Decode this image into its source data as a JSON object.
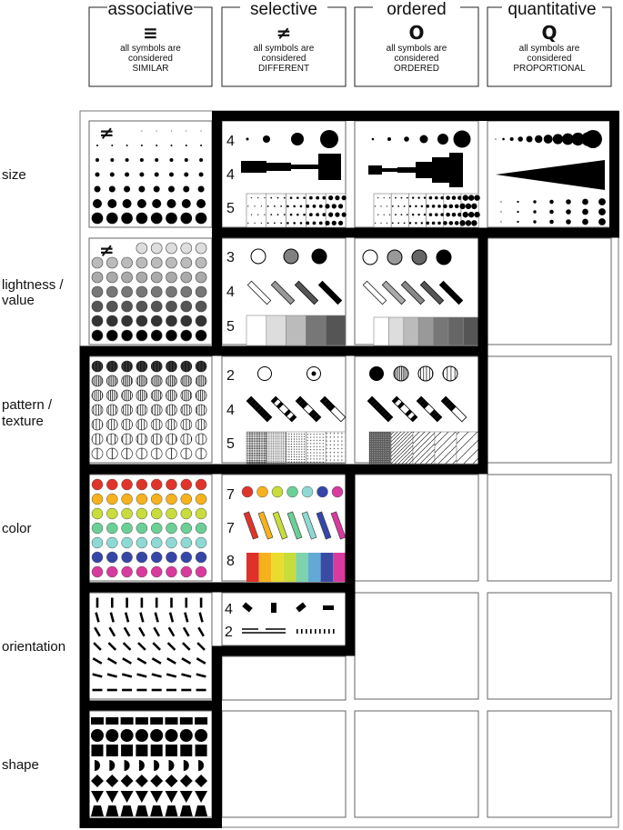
{
  "columns": [
    {
      "title": "associative",
      "symbol": "≡",
      "icon": "equivalent-icon",
      "line1": "all symbols are",
      "line2": "considered",
      "line3": "SIMILAR"
    },
    {
      "title": "selective",
      "symbol": "≠",
      "icon": "not-equal-icon",
      "line1": "all symbols are",
      "line2": "considered",
      "line3": "DIFFERENT"
    },
    {
      "title": "ordered",
      "symbol": "O",
      "icon": "circle-o-icon",
      "line1": "all symbols are",
      "line2": "considered",
      "line3": "ORDERED"
    },
    {
      "title": "quantitative",
      "symbol": "Q",
      "icon": "q-icon",
      "line1": "all symbols are",
      "line2": "considered",
      "line3": "PROPORTIONAL"
    }
  ],
  "rows": [
    {
      "label1": "size",
      "label2": ""
    },
    {
      "label1": "lightness /",
      "label2": "value"
    },
    {
      "label1": "pattern /",
      "label2": "texture"
    },
    {
      "label1": "color",
      "label2": ""
    },
    {
      "label1": "orientation",
      "label2": ""
    },
    {
      "label1": "shape",
      "label2": ""
    }
  ],
  "cell_symbol": "≠",
  "selective_counts": {
    "size": [
      "4",
      "4",
      "5"
    ],
    "lightness": [
      "3",
      "4",
      "5"
    ],
    "pattern": [
      "2",
      "4",
      "5"
    ],
    "color": [
      "7",
      "7",
      "8"
    ],
    "orientation": [
      "4",
      "2"
    ]
  },
  "colors": {
    "rows": [
      "#e0342a",
      "#f6b21c",
      "#c8dc3c",
      "#6ccf96",
      "#8ed9d4",
      "#3546a8",
      "#d93a9e"
    ],
    "stripes": [
      "#e0302a",
      "#f6b21c",
      "#eadc2e",
      "#c8dc3c",
      "#7ed3ae",
      "#62a9d6",
      "#3a4ba6",
      "#d93a9e"
    ],
    "grays_assoc": [
      "#dddddd",
      "#bbbbbb",
      "#aaaaaa",
      "#777777",
      "#555555",
      "#333333",
      "#000000"
    ],
    "grays_sel_steps": [
      "#ffffff",
      "#dddddd",
      "#bbbbbb",
      "#777777",
      "#555555"
    ],
    "grays_ord_steps": [
      "#ffffff",
      "#dddddd",
      "#bbbbbb",
      "#999999",
      "#777777",
      "#666666",
      "#555555"
    ]
  }
}
